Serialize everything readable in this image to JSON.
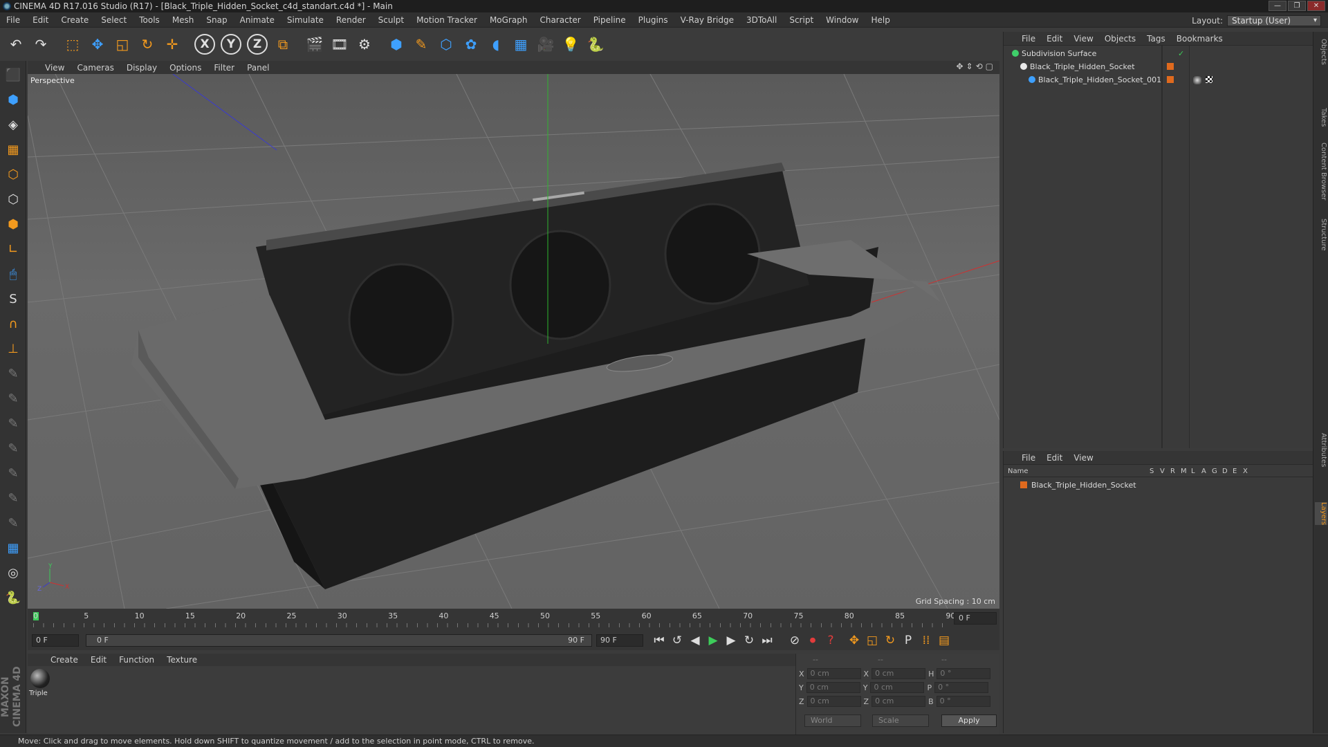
{
  "window": {
    "title": "CINEMA 4D R17.016 Studio (R17) - [Black_Triple_Hidden_Socket_c4d_standart.c4d *] - Main",
    "buttons": [
      "—",
      "❐",
      "✕"
    ]
  },
  "menubar": [
    "File",
    "Edit",
    "Create",
    "Select",
    "Tools",
    "Mesh",
    "Snap",
    "Animate",
    "Simulate",
    "Render",
    "Sculpt",
    "Motion Tracker",
    "MoGraph",
    "Character",
    "Pipeline",
    "Plugins",
    "V-Ray Bridge",
    "3DToAll",
    "Script",
    "Window",
    "Help"
  ],
  "layout": {
    "label": "Layout:",
    "value": "Startup (User)"
  },
  "toolbar": {
    "icons": [
      {
        "name": "undo-icon",
        "glyph": "↶",
        "tone": ""
      },
      {
        "name": "redo-icon",
        "glyph": "↷",
        "tone": "dim"
      },
      {
        "name": "live-selection-icon",
        "glyph": "⬚",
        "tone": "orange"
      },
      {
        "name": "move-icon",
        "glyph": "✥",
        "tone": "blue"
      },
      {
        "name": "scale-icon",
        "glyph": "◱",
        "tone": "orange"
      },
      {
        "name": "rotate-icon",
        "glyph": "↻",
        "tone": "orange"
      },
      {
        "name": "transform-icon",
        "glyph": "✛",
        "tone": "orange"
      }
    ],
    "axes": [
      "X",
      "Y",
      "Z"
    ],
    "icons2": [
      {
        "name": "coordinate-system-icon",
        "glyph": "⧉",
        "tone": "orange"
      },
      {
        "name": "render-view-icon",
        "glyph": "🎬",
        "tone": ""
      },
      {
        "name": "render-picture-viewer-icon",
        "glyph": "🎞",
        "tone": ""
      },
      {
        "name": "render-settings-icon",
        "glyph": "⚙",
        "tone": ""
      },
      {
        "name": "cube-icon",
        "glyph": "⬢",
        "tone": "blue"
      },
      {
        "name": "spline-pen-icon",
        "glyph": "✎",
        "tone": "orange"
      },
      {
        "name": "subdivision-icon",
        "glyph": "⬡",
        "tone": "blue"
      },
      {
        "name": "mograph-cloner-icon",
        "glyph": "✿",
        "tone": "blue"
      },
      {
        "name": "deformer-icon",
        "glyph": "◖",
        "tone": "blue"
      },
      {
        "name": "floor-icon",
        "glyph": "▦",
        "tone": "blue"
      },
      {
        "name": "camera-icon",
        "glyph": "🎥",
        "tone": ""
      },
      {
        "name": "light-icon",
        "glyph": "💡",
        "tone": ""
      },
      {
        "name": "python-icon",
        "glyph": "🐍",
        "tone": "blue"
      }
    ]
  },
  "lefttools": [
    {
      "name": "make-editable-icon",
      "glyph": "⬛",
      "tone": ""
    },
    {
      "name": "model-mode-icon",
      "glyph": "⬢",
      "tone": "blue"
    },
    {
      "name": "texture-mode-icon",
      "glyph": "◈",
      "tone": ""
    },
    {
      "name": "workplane-mode-icon",
      "glyph": "▦",
      "tone": "orange"
    },
    {
      "name": "points-mode-icon",
      "glyph": "⬡",
      "tone": "orange"
    },
    {
      "name": "edges-mode-icon",
      "glyph": "⬡",
      "tone": ""
    },
    {
      "name": "polygons-mode-icon",
      "glyph": "⬢",
      "tone": "orange"
    },
    {
      "name": "axis-mode-icon",
      "glyph": "∟",
      "tone": "orange"
    },
    {
      "name": "tweak-mode-icon",
      "glyph": "🖱",
      "tone": "blue"
    },
    {
      "name": "snapping-icon",
      "glyph": "S",
      "tone": ""
    },
    {
      "name": "magnet-icon",
      "glyph": "∩",
      "tone": "orange"
    },
    {
      "name": "workplane-icon",
      "glyph": "⊥",
      "tone": "orange"
    },
    {
      "name": "sculpt-brush-1-icon",
      "glyph": "✎",
      "tone": "dim"
    },
    {
      "name": "sculpt-brush-2-icon",
      "glyph": "✎",
      "tone": "dim"
    },
    {
      "name": "sculpt-brush-3-icon",
      "glyph": "✎",
      "tone": "dim"
    },
    {
      "name": "sculpt-brush-4-icon",
      "glyph": "✎",
      "tone": "dim"
    },
    {
      "name": "sculpt-brush-5-icon",
      "glyph": "✎",
      "tone": "dim"
    },
    {
      "name": "sculpt-brush-6-icon",
      "glyph": "✎",
      "tone": "dim"
    },
    {
      "name": "sculpt-brush-7-icon",
      "glyph": "✎",
      "tone": "dim"
    },
    {
      "name": "grid-lock-icon",
      "glyph": "▦",
      "tone": "blue"
    },
    {
      "name": "paint-icon",
      "glyph": "◎",
      "tone": ""
    },
    {
      "name": "python-tool-icon",
      "glyph": "🐍",
      "tone": "blue"
    }
  ],
  "maxon": "MAXON CINEMA 4D",
  "viewport": {
    "menu": [
      "View",
      "Cameras",
      "Display",
      "Options",
      "Filter",
      "Panel"
    ],
    "camera": "Perspective",
    "grid_spacing": "Grid Spacing : 10 cm",
    "nav_icons": [
      "✥",
      "⇕",
      "⟲",
      "▢"
    ],
    "axis_labels": {
      "x": "X",
      "y": "Y",
      "z": "Z"
    }
  },
  "timeline": {
    "ticks": [
      "0",
      "5",
      "10",
      "15",
      "20",
      "25",
      "30",
      "35",
      "40",
      "45",
      "50",
      "55",
      "60",
      "65",
      "70",
      "75",
      "80",
      "85",
      "90"
    ],
    "current_frame": "0 F"
  },
  "transport": {
    "start": "0 F",
    "range_left": "0 F",
    "range_right": "90 F",
    "end": "90 F",
    "buttons": [
      {
        "name": "go-to-start-icon",
        "glyph": "⏮",
        "tone": ""
      },
      {
        "name": "prev-key-icon",
        "glyph": "↺",
        "tone": ""
      },
      {
        "name": "prev-frame-icon",
        "glyph": "◀",
        "tone": ""
      },
      {
        "name": "play-icon",
        "glyph": "▶",
        "tone": "green"
      },
      {
        "name": "next-frame-icon",
        "glyph": "▶",
        "tone": ""
      },
      {
        "name": "next-key-icon",
        "glyph": "↻",
        "tone": ""
      },
      {
        "name": "go-to-end-icon",
        "glyph": "⏭",
        "tone": ""
      }
    ],
    "buttons2": [
      {
        "name": "motion-record-icon",
        "glyph": "⊘",
        "tone": ""
      },
      {
        "name": "record-icon",
        "glyph": "⏺",
        "tone": "red"
      },
      {
        "name": "autokey-icon",
        "glyph": "?",
        "tone": "red"
      },
      {
        "name": "key-move-icon",
        "glyph": "✥",
        "tone": "orange"
      },
      {
        "name": "key-scale-icon",
        "glyph": "◱",
        "tone": "orange"
      },
      {
        "name": "key-rotate-icon",
        "glyph": "↻",
        "tone": "orange"
      },
      {
        "name": "key-param-icon",
        "glyph": "P",
        "tone": ""
      },
      {
        "name": "key-pla-icon",
        "glyph": "⁞⁞",
        "tone": "orange"
      },
      {
        "name": "timeline-icon",
        "glyph": "▤",
        "tone": "orange"
      }
    ]
  },
  "material": {
    "menu": [
      "Create",
      "Edit",
      "Function",
      "Texture"
    ],
    "label": "Triple"
  },
  "coords": {
    "headers": [
      "--",
      "--",
      "--"
    ],
    "rows": [
      {
        "a": "X",
        "av": "0 cm",
        "b": "X",
        "bv": "0 cm",
        "c": "H",
        "cv": "0 °"
      },
      {
        "a": "Y",
        "av": "0 cm",
        "b": "Y",
        "bv": "0 cm",
        "c": "P",
        "cv": "0 °"
      },
      {
        "a": "Z",
        "av": "0 cm",
        "b": "Z",
        "bv": "0 cm",
        "c": "B",
        "cv": "0 °"
      }
    ],
    "mode": "World",
    "type": "Scale",
    "apply": "Apply"
  },
  "objects_panel": {
    "menu": [
      "File",
      "Edit",
      "View",
      "Objects",
      "Tags",
      "Bookmarks"
    ],
    "items": [
      {
        "name": "Subdivision Surface",
        "indent": 0,
        "color": "#3fcf6a"
      },
      {
        "name": "Black_Triple_Hidden_Socket",
        "indent": 1,
        "color": "#e8e8e8"
      },
      {
        "name": "Black_Triple_Hidden_Socket_001",
        "indent": 2,
        "color": "#3ea0ff"
      }
    ]
  },
  "layers_panel": {
    "menu": [
      "File",
      "Edit",
      "View"
    ],
    "headers": [
      "Name",
      "S",
      "V",
      "R",
      "M",
      "L",
      "A",
      "G",
      "D",
      "E",
      "X"
    ],
    "layer": "Black_Triple_Hidden_Socket",
    "layer_color": "#e06a1e"
  },
  "side_tabs": [
    "Objects",
    "Takes",
    "Content Browser",
    "Structure",
    "Attributes",
    "Layers"
  ],
  "status": "Move: Click and drag to move elements. Hold down SHIFT to quantize movement / add to the selection in point mode, CTRL to remove."
}
